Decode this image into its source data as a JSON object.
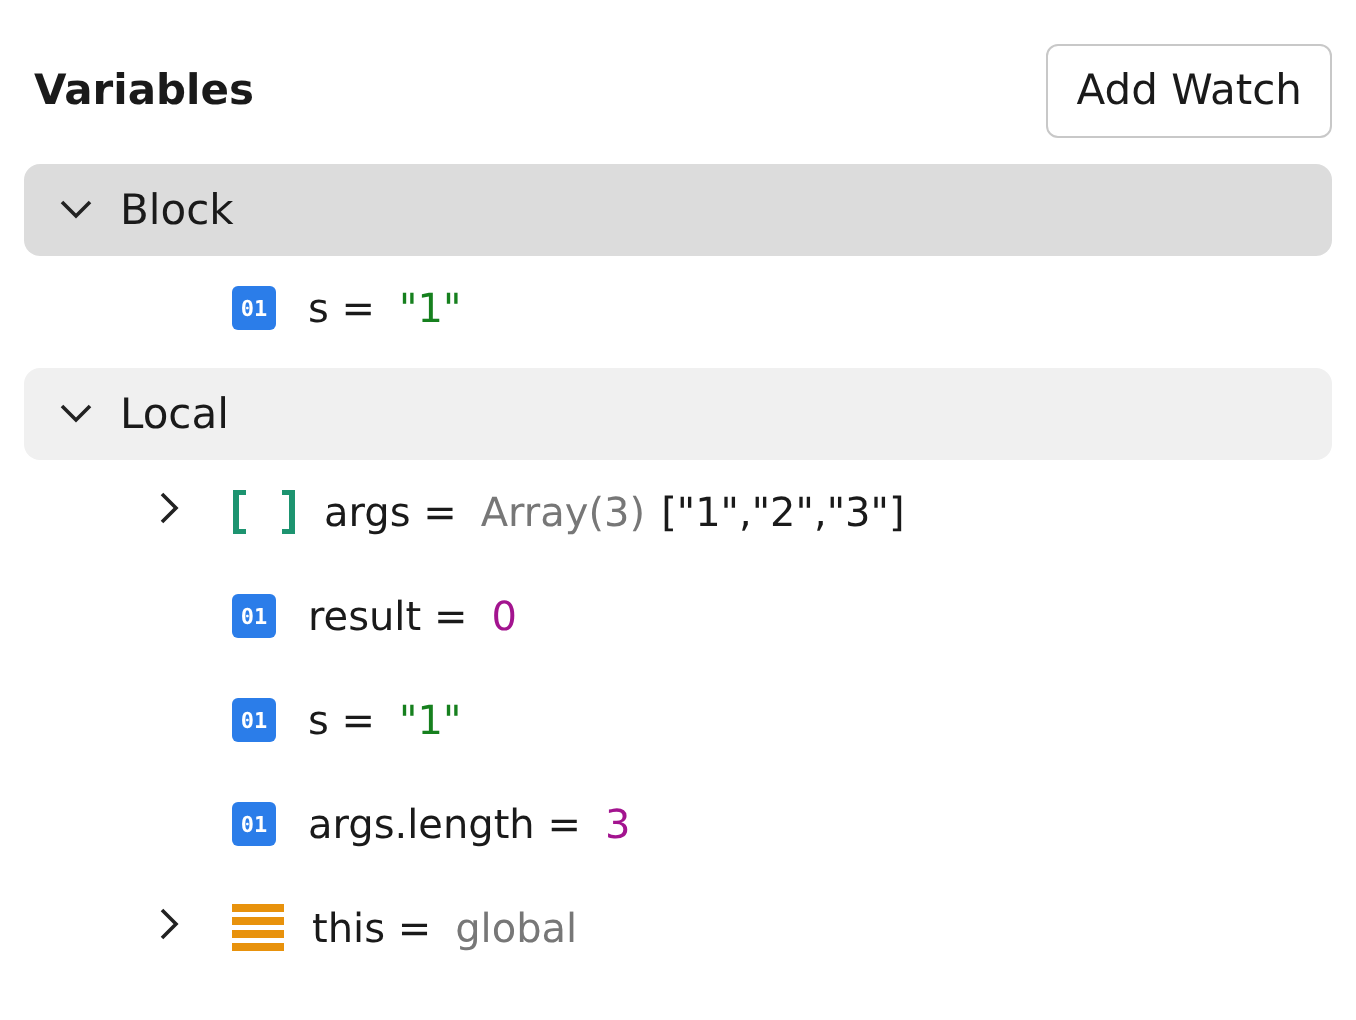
{
  "title": "Variables",
  "add_watch": "Add Watch",
  "scopes": [
    {
      "name": "Block",
      "expanded": true,
      "selected": true,
      "variables": [
        {
          "kind": "primitive",
          "badge": "01",
          "name": "s =",
          "value": [
            {
              "kind": "string",
              "text": "\"1\""
            }
          ]
        }
      ]
    },
    {
      "name": "Local",
      "expanded": true,
      "selected": false,
      "variables": [
        {
          "kind": "array",
          "expanded": false,
          "name": "args =",
          "value": [
            {
              "kind": "preview",
              "text": "Array(3)"
            },
            {
              "kind": "plain",
              "text": "[\"1\",\"2\",\"3\"]"
            }
          ]
        },
        {
          "kind": "primitive",
          "badge": "01",
          "name": "result =",
          "value": [
            {
              "kind": "number",
              "text": "0"
            }
          ]
        },
        {
          "kind": "primitive",
          "badge": "01",
          "name": "s =",
          "value": [
            {
              "kind": "string",
              "text": "\"1\""
            }
          ]
        },
        {
          "kind": "primitive",
          "badge": "01",
          "name": "args.length =",
          "value": [
            {
              "kind": "number",
              "text": "3"
            }
          ]
        },
        {
          "kind": "object",
          "expanded": false,
          "name": "this =",
          "value": [
            {
              "kind": "preview",
              "text": "global"
            }
          ]
        }
      ]
    }
  ]
}
